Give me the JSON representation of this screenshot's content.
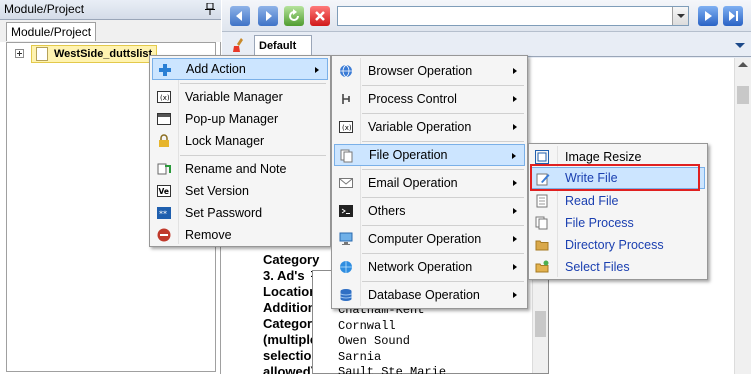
{
  "left_panel": {
    "title": "Module/Project",
    "tab_label": "Module/Project",
    "tree_item": "WestSide_duttslist"
  },
  "toolbar": {
    "url_value": ""
  },
  "tabs": {
    "default_label": "Default"
  },
  "content": {
    "labels": [
      "Category",
      "3. Ad's",
      "Location",
      "Additional",
      "Categories",
      "(multiple",
      "selection is",
      "allowed)"
    ],
    "colon": ":",
    "list_items": [
      "Chatham-Kent",
      "Cornwall",
      "Owen Sound",
      "Sarnia",
      "Sault Ste Marie"
    ]
  },
  "context_menu": {
    "items": [
      {
        "label": "Add Action",
        "icon": "plus-icon",
        "submenu": true
      },
      {
        "label": "Variable Manager",
        "icon": "variable-icon"
      },
      {
        "label": "Pop-up Manager",
        "icon": "window-icon"
      },
      {
        "label": "Lock Manager",
        "icon": "lock-icon"
      },
      {
        "label": "Rename and Note",
        "icon": "rename-icon"
      },
      {
        "label": "Set Version",
        "icon": "version-icon"
      },
      {
        "label": "Set Password",
        "icon": "password-icon"
      },
      {
        "label": "Remove",
        "icon": "remove-icon"
      }
    ]
  },
  "action_menu": {
    "items": [
      {
        "label": "Browser Operation",
        "icon": "globe-icon"
      },
      {
        "label": "Process Control",
        "icon": "process-icon"
      },
      {
        "label": "Variable Operation",
        "icon": "variable-icon"
      },
      {
        "label": "File Operation",
        "icon": "file-icon"
      },
      {
        "label": "Email Operation",
        "icon": "email-icon"
      },
      {
        "label": "Others",
        "icon": "terminal-icon"
      },
      {
        "label": "Computer Operation",
        "icon": "computer-icon"
      },
      {
        "label": "Network Operation",
        "icon": "network-icon"
      },
      {
        "label": "Database Operation",
        "icon": "database-icon"
      }
    ]
  },
  "file_menu": {
    "items": [
      {
        "label": "Image Resize",
        "icon": "image-resize-icon"
      },
      {
        "label": "Write File",
        "icon": "write-file-icon"
      },
      {
        "label": "Read File",
        "icon": "read-file-icon"
      },
      {
        "label": "File Process",
        "icon": "file-process-icon"
      },
      {
        "label": "Directory Process",
        "icon": "folder-icon"
      },
      {
        "label": "Select Files",
        "icon": "select-files-icon"
      }
    ]
  },
  "colors": {
    "highlight_bg": "#cce5ff",
    "highlight_border": "#7ab0e8",
    "red_marker": "#e02020",
    "link_text": "#1a3fb0"
  }
}
